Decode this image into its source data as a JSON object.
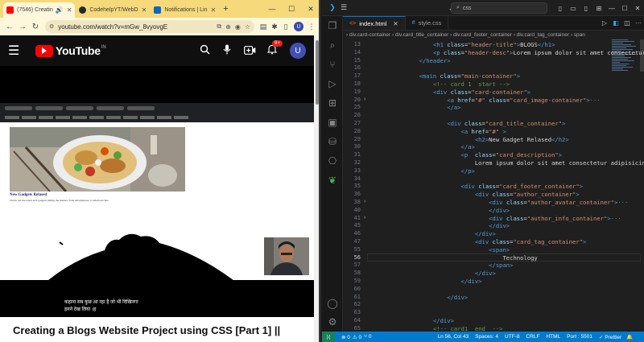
{
  "browser": {
    "tabs": [
      {
        "label": "(7546) Creatin",
        "color": "#ff0000",
        "active": true
      },
      {
        "label": "CodehelpYT/WebD",
        "color": "#24292f",
        "active": false
      },
      {
        "label": "Notifications | Lin",
        "color": "#0a66c2",
        "active": false
      }
    ],
    "new_tab": "+",
    "url": "youtube.com/watch?v=mGw_8vyovgE"
  },
  "youtube": {
    "logo_text": "YouTube",
    "region": "IN",
    "notification_count": "9+",
    "user_initial": "U",
    "inner_card_title": "New Gadgets Relased",
    "inner_card_desc": "Check out the latest tech gadgets hitting the market, from smartphones to smartwatches.",
    "subtitle_line1": "कहाना सब कुछ आ रहा है जो भी दिखिनगा",
    "subtitle_line2": "हमने देख लिया ।ह",
    "video_title": "Creating a Blogs Website Project using CSS [Part 1] ||"
  },
  "vscode": {
    "search": "css",
    "tabs": [
      {
        "label": "index.html",
        "icon": "<>",
        "icon_color": "#e37933",
        "active": true
      },
      {
        "label": "style.css",
        "icon": "#",
        "icon_color": "#42a5f5",
        "active": false
      }
    ],
    "breadcrumb": "› div.card-container › div.card_title_container › div.card_footer_container › div.card_tag_container › span",
    "lines": [
      {
        "n": "13",
        "fold": "",
        "html": "            <span class='t'>&lt;h1</span> <span class='a'>class</span>=<span class='s'>\"header-title\"</span><span class='t'>&gt;</span>BLOGS<span class='t'>&lt;/h1&gt;</span>"
      },
      {
        "n": "14",
        "fold": "",
        "html": "            <span class='t'>&lt;p</span> <span class='a'>class</span>=<span class='s'>\"header-desc\"</span><span class='t'>&gt;</span>Lorem ipsum dolor sit amet consectetur"
      },
      {
        "n": "15",
        "fold": "",
        "html": "        <span class='t'>&lt;/header&gt;</span>"
      },
      {
        "n": "16",
        "fold": "",
        "html": ""
      },
      {
        "n": "17",
        "fold": "",
        "html": "        <span class='t'>&lt;main</span> <span class='a'>class</span>=<span class='s'>\"main-container\"</span><span class='t'>&gt;</span>"
      },
      {
        "n": "18",
        "fold": "",
        "html": "            <span class='c'>&lt;!-- card 1  start --&gt;</span>"
      },
      {
        "n": "19",
        "fold": "",
        "html": "            <span class='t'>&lt;div</span> <span class='a'>class</span>=<span class='s'>\"card-container\"</span><span class='t'>&gt;</span>"
      },
      {
        "n": "20",
        "fold": "›",
        "html": "                <span class='t'>&lt;a</span> <span class='a'>href</span>=<span class='s'>\"#\"</span> <span class='a'>class</span>=<span class='s'>\"card_image-container\"</span><span class='t'>&gt;</span><span class='p'>···</span>"
      },
      {
        "n": "25",
        "fold": "",
        "html": "                <span class='t'>&lt;/a&gt;</span>"
      },
      {
        "n": "26",
        "fold": "",
        "html": ""
      },
      {
        "n": "27",
        "fold": "",
        "html": "                <span class='t'>&lt;div</span> <span class='a'>class</span>=<span class='s'>\"card_title_container\"</span><span class='t'>&gt;</span>"
      },
      {
        "n": "28",
        "fold": "",
        "html": "                    <span class='t'>&lt;a</span> <span class='a'>href</span>=<span class='s'>\"#\"</span> <span class='t'>&gt;</span>"
      },
      {
        "n": "29",
        "fold": "",
        "html": "                        <span class='t'>&lt;h2&gt;</span>New Gadget Relased<span class='t'>&lt;/h2&gt;</span>"
      },
      {
        "n": "30",
        "fold": "",
        "html": "                    <span class='t'>&lt;/a&gt;</span>"
      },
      {
        "n": "31",
        "fold": "",
        "html": "                    <span class='t'>&lt;p</span>  <span class='a'>class</span>=<span class='s'>\"card_description\"</span><span class='t'>&gt;</span>"
      },
      {
        "n": "32",
        "fold": "",
        "html": "                        Lorem ipsum dolor sit amet consectetur adipisicing"
      },
      {
        "n": "33",
        "fold": "",
        "html": "                    <span class='t'>&lt;/p&gt;</span>"
      },
      {
        "n": "34",
        "fold": "",
        "html": ""
      },
      {
        "n": "35",
        "fold": "",
        "html": "                    <span class='t'>&lt;div</span> <span class='a'>class</span>=<span class='s'>\"card_footer_container\"</span><span class='t'>&gt;</span>"
      },
      {
        "n": "36",
        "fold": "",
        "html": "                        <span class='t'>&lt;div</span> <span class='a'>class</span>=<span class='s'>\"author_container\"</span><span class='t'>&gt;</span>"
      },
      {
        "n": "38",
        "fold": "›",
        "html": "                            <span class='t'>&lt;div</span> <span class='a'>class</span>=<span class='s'>\"author_avatar_container\"</span><span class='t'>&gt;</span><span class='p'>···</span>"
      },
      {
        "n": "40",
        "fold": "",
        "html": "                            <span class='t'>&lt;/div&gt;</span>"
      },
      {
        "n": "41",
        "fold": "›",
        "html": "                            <span class='t'>&lt;div</span> <span class='a'>class</span>=<span class='s'>\"author_info_container\"</span><span class='t'>&gt;</span><span class='p'>···</span>"
      },
      {
        "n": "45",
        "fold": "",
        "html": "                            <span class='t'>&lt;/div&gt;</span>"
      },
      {
        "n": "46",
        "fold": "",
        "html": "                        <span class='t'>&lt;/div&gt;</span>"
      },
      {
        "n": "47",
        "fold": "",
        "html": "                        <span class='t'>&lt;div</span> <span class='a'>class</span>=<span class='s'>\"card_tag_container\"</span><span class='t'>&gt;</span>"
      },
      {
        "n": "55",
        "fold": "",
        "html": "                            <span class='t'>&lt;span&gt;</span>"
      },
      {
        "n": "56",
        "fold": "",
        "html": "                                Technology"
      },
      {
        "n": "57",
        "fold": "",
        "html": "                            <span class='t'>&lt;/span&gt;</span>"
      },
      {
        "n": "58",
        "fold": "",
        "html": "                        <span class='t'>&lt;/div&gt;</span>"
      },
      {
        "n": "59",
        "fold": "",
        "html": "                    <span class='t'>&lt;/div&gt;</span>"
      },
      {
        "n": "60",
        "fold": "",
        "html": ""
      },
      {
        "n": "61",
        "fold": "",
        "html": "                <span class='t'>&lt;/div&gt;</span>"
      },
      {
        "n": "62",
        "fold": "",
        "html": ""
      },
      {
        "n": "63",
        "fold": "",
        "html": ""
      },
      {
        "n": "64",
        "fold": "",
        "html": "            <span class='t'>&lt;/div&gt;</span>"
      },
      {
        "n": "65",
        "fold": "",
        "html": "            <span class='c'>&lt;!-- card1  end  --&gt;</span>"
      }
    ],
    "status": {
      "errors": "⊗ 0",
      "warnings": "⚠ 0",
      "ports": "⑂ 0",
      "position": "Ln 56, Col 43",
      "spaces": "Spaces: 4",
      "encoding": "UTF-8",
      "eol": "CRLF",
      "lang": "HTML",
      "port": "Port : 5501",
      "prettier": "✓ Prettier"
    }
  }
}
